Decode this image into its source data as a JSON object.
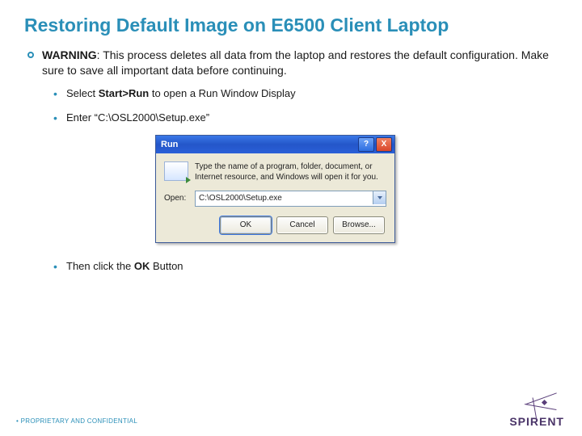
{
  "title": "Restoring Default Image on E6500 Client Laptop",
  "warning": {
    "label": "WARNING",
    "text": ": This process deletes all data from the laptop and restores the default configuration. Make sure to save all important data before continuing."
  },
  "steps": {
    "select_prefix": "Select ",
    "select_bold": "Start>Run",
    "select_suffix": " to open a Run Window Display",
    "enter": "Enter “C:\\OSL2000\\Setup.exe”",
    "then_prefix": "Then click the ",
    "then_bold": "OK",
    "then_suffix": " Button"
  },
  "run_dialog": {
    "title": "Run",
    "help": "?",
    "close": "X",
    "message": "Type the name of a program, folder, document, or Internet resource, and Windows will open it for you.",
    "open_label": "Open:",
    "open_value": "C:\\OSL2000\\Setup.exe",
    "buttons": {
      "ok": "OK",
      "cancel": "Cancel",
      "browse": "Browse..."
    }
  },
  "footer": "PROPRIETARY AND CONFIDENTIAL",
  "logo": "SPIRENT"
}
